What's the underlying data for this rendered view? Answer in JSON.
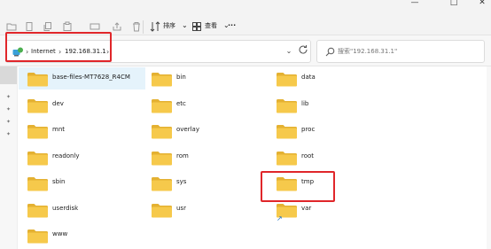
{
  "window": {
    "minimize": "—",
    "maximize": "□",
    "close": "✕"
  },
  "toolbar": {
    "icons": [
      "new-folder-icon",
      "cut-icon",
      "copy-icon",
      "paste-icon",
      "rename-icon",
      "share-icon",
      "delete-icon"
    ],
    "sort_label": "排序",
    "view_label": "查看",
    "more_label": "···",
    "chevron": "⌄"
  },
  "address": {
    "icon": "network-icon",
    "chev": "›",
    "crumbs": [
      "Internet",
      "192.168.31.1"
    ],
    "dropdown": "⌄",
    "refresh_icon": "refresh-icon"
  },
  "search": {
    "placeholder": "搜索\"192.168.31.1\""
  },
  "folders": [
    {
      "name": "base-files-MT7628_R4CM",
      "selected": true
    },
    {
      "name": "bin"
    },
    {
      "name": "data"
    },
    {
      "name": "dev"
    },
    {
      "name": "etc"
    },
    {
      "name": "lib"
    },
    {
      "name": "mnt"
    },
    {
      "name": "overlay"
    },
    {
      "name": "proc"
    },
    {
      "name": "readonly"
    },
    {
      "name": "rom"
    },
    {
      "name": "root"
    },
    {
      "name": "sbin"
    },
    {
      "name": "sys"
    },
    {
      "name": "tmp",
      "highlighted": true
    },
    {
      "name": "userdisk"
    },
    {
      "name": "usr"
    },
    {
      "name": "var",
      "shortcut": true
    },
    {
      "name": "www"
    }
  ],
  "colors": {
    "highlight": "#e0262a",
    "folder": "#f6c94b",
    "selection": "#e5f3fb"
  }
}
